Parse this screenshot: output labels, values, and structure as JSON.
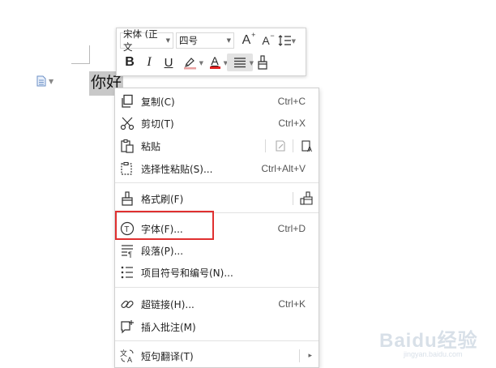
{
  "document": {
    "text": "你好"
  },
  "toolbar": {
    "font_name": "宋体 (正文",
    "font_size": "四号",
    "increase_font": "A",
    "decrease_font": "A",
    "bold": "B",
    "italic": "I",
    "underline": "U",
    "font_color": "A",
    "font_color_hex": "#e02020"
  },
  "menu": {
    "copy": {
      "label": "复制(C)",
      "shortcut": "Ctrl+C"
    },
    "cut": {
      "label": "剪切(T)",
      "shortcut": "Ctrl+X"
    },
    "paste": {
      "label": "粘贴"
    },
    "paste_special": {
      "label": "选择性粘贴(S)...",
      "shortcut": "Ctrl+Alt+V"
    },
    "format_painter": {
      "label": "格式刷(F)"
    },
    "font": {
      "label": "字体(F)...",
      "shortcut": "Ctrl+D"
    },
    "paragraph": {
      "label": "段落(P)..."
    },
    "bullets": {
      "label": "项目符号和编号(N)..."
    },
    "hyperlink": {
      "label": "超链接(H)...",
      "shortcut": "Ctrl+K"
    },
    "comment": {
      "label": "插入批注(M)"
    },
    "translate": {
      "label": "短句翻译(T)"
    }
  },
  "highlight_color": "#e03030",
  "watermark": {
    "text": "Baidu经验",
    "sub": "jingyan.baidu.com"
  }
}
